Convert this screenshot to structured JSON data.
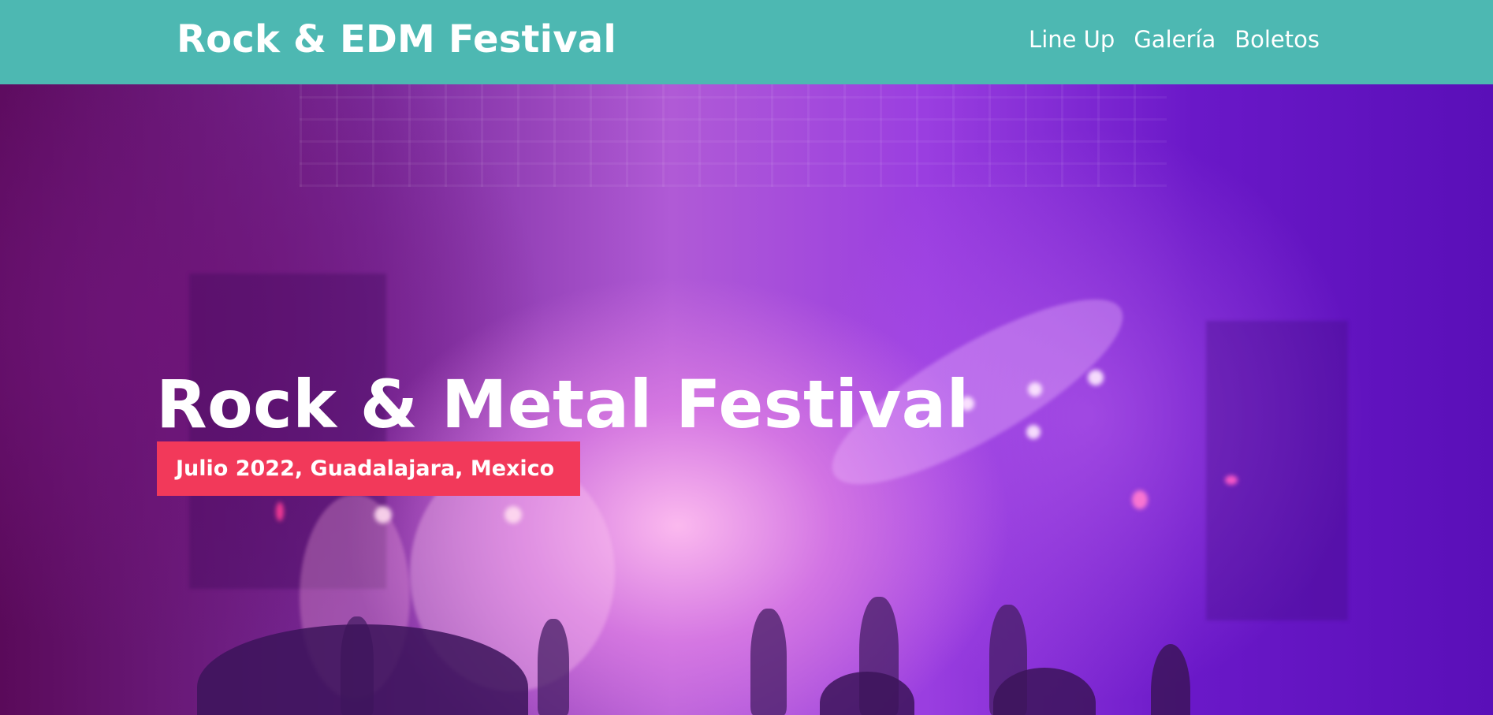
{
  "header": {
    "brand": "Rock & EDM Festival",
    "nav": [
      {
        "label": "Line Up"
      },
      {
        "label": "Galería"
      },
      {
        "label": "Boletos"
      }
    ]
  },
  "hero": {
    "title": "Rock & Metal Festival",
    "date_location": "Julio 2022, Guadalajara, Mexico",
    "background_image": "concert-stage-purple-lights"
  },
  "colors": {
    "header_bg": "#4db8b2",
    "badge_bg": "#f2395a",
    "text": "#ffffff"
  }
}
